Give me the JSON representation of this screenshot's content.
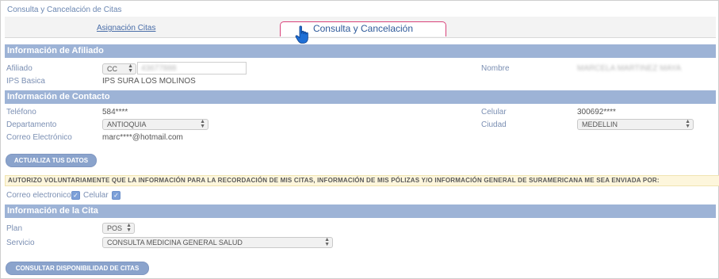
{
  "window_title": "Consulta y Cancelación de Citas",
  "tabs": {
    "asignacion": "Asignación Citas",
    "consulta": "Consulta y Cancelación"
  },
  "afiliado_section": {
    "title": "Información de Afiliado",
    "afiliado_label": "Afiliado",
    "doc_type": "CC",
    "doc_number": "43677888",
    "nombre_label": "Nombre",
    "nombre_value": "MARCELA MARTINEZ MAYA",
    "ips_label": "IPS Basica",
    "ips_value": "IPS SURA LOS MOLINOS"
  },
  "contacto_section": {
    "title": "Información de Contacto",
    "telefono_label": "Teléfono",
    "telefono_value": "584****",
    "celular_label": "Celular",
    "celular_value": "300692****",
    "departamento_label": "Departamento",
    "departamento_value": "ANTIOQUIA",
    "ciudad_label": "Ciudad",
    "ciudad_value": "MEDELLIN",
    "correo_label": "Correo Electrónico",
    "correo_value": "marc****@hotmail.com",
    "update_button": "ACTUALIZA TUS DATOS"
  },
  "notice": "AUTORIZO VOLUNTARIAMENTE QUE LA INFORMACIÓN PARA LA RECORDACIÓN DE MIS CITAS, INFORMACIÓN DE MIS PÓLIZAS Y/O INFORMACIÓN GENERAL DE SURAMERICANA ME SEA ENVIADA POR:",
  "consent": {
    "correo_label": "Correo electronico",
    "celular_label": "Celular",
    "correo_checked": true,
    "celular_checked": true
  },
  "cita_section": {
    "title": "Información de la Cita",
    "plan_label": "Plan",
    "plan_value": "POS",
    "servicio_label": "Servicio",
    "servicio_value": "CONSULTA MEDICINA GENERAL SALUD",
    "consultar_button": "CONSULTAR DISPONIBILIDAD DE CITAS"
  },
  "colors": {
    "section_bar": "#9db3d6",
    "label": "#7b8fb3",
    "active_tab_border": "#d9427a",
    "button": "#8aa3cc"
  }
}
